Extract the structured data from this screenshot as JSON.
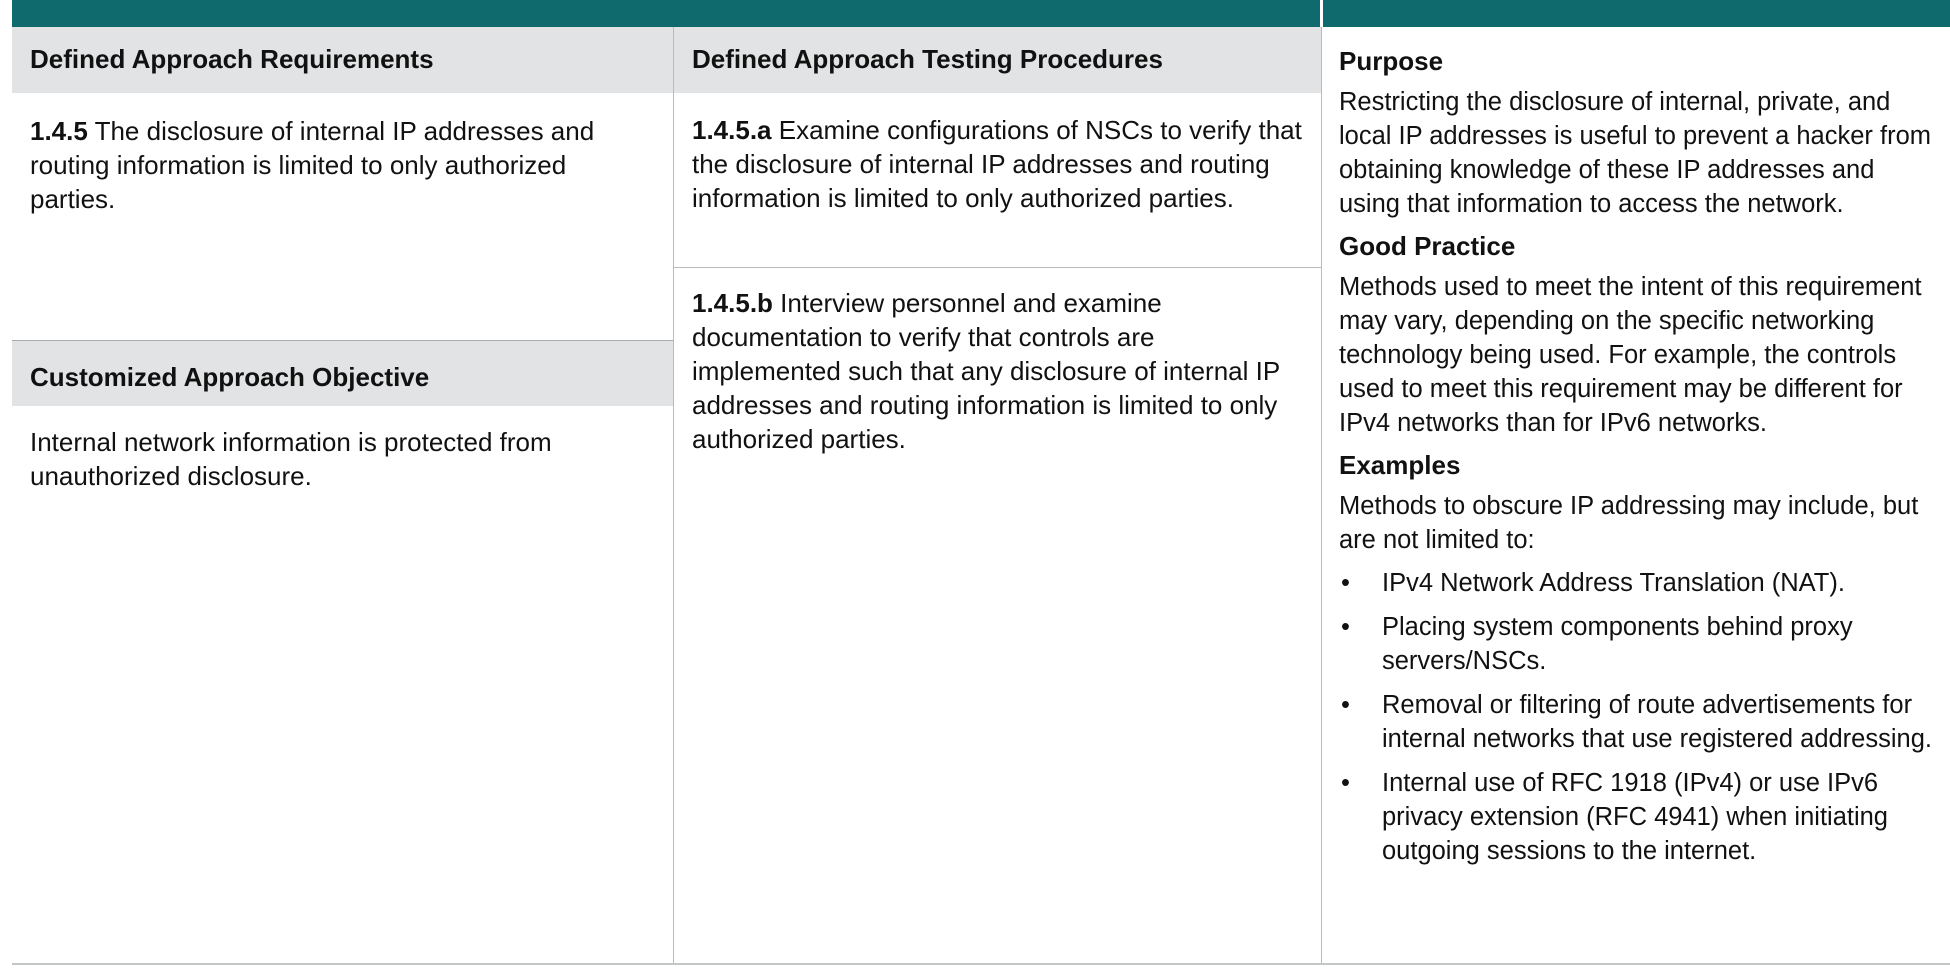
{
  "requirements": {
    "header": "Defined Approach Requirements",
    "id": "1.4.5",
    "text": " The disclosure of internal IP addresses and routing information is limited to only authorized parties.",
    "customized_header": "Customized Approach Objective",
    "customized_text": "Internal network information is protected from unauthorized disclosure."
  },
  "testing": {
    "header": "Defined Approach Testing Procedures",
    "procedures": [
      {
        "id": "1.4.5.a",
        "text": " Examine configurations of NSCs to verify that the disclosure of internal IP addresses and routing information is limited to only authorized parties."
      },
      {
        "id": "1.4.5.b",
        "text": " Interview personnel and examine documentation to verify that controls are implemented such that any disclosure of internal IP addresses and routing information is limited to only authorized parties."
      }
    ]
  },
  "guidance": {
    "purpose_heading": "Purpose",
    "purpose_text": "Restricting the disclosure of internal, private, and local IP addresses is useful to prevent a hacker from obtaining knowledge of these IP addresses and using that information to access the network.",
    "good_practice_heading": "Good Practice",
    "good_practice_text": "Methods used to meet the intent of this requirement may vary, depending on the specific networking technology being used. For example, the controls used to meet this requirement may be different for IPv4 networks than for IPv6 networks.",
    "examples_heading": "Examples",
    "examples_intro": "Methods to obscure IP addressing may include, but are not limited to:",
    "bullet": "•",
    "examples": [
      "IPv4 Network Address Translation (NAT).",
      "Placing system components behind proxy servers/NSCs.",
      "Removal or filtering of route advertisements for internal networks that use registered addressing.",
      "Internal use of RFC 1918 (IPv4) or use IPv6 privacy extension (RFC 4941) when initiating outgoing sessions to the internet."
    ]
  },
  "colors": {
    "header_bar": "#0f6a6e",
    "header_fill": "#e1e3e4",
    "rule": "#b9bcbd"
  }
}
